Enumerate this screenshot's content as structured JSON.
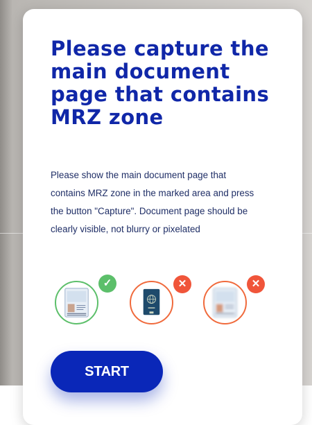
{
  "modal": {
    "title": "Please capture the main document page that contains MRZ zone",
    "description": "Please show the main document page that contains MRZ zone in the marked area and press the button \"Capture\". Document page should be clearly visible, not blurry or pixelated",
    "start_label": "START"
  },
  "examples": [
    {
      "image_icon": "document-page-icon",
      "status": "correct",
      "badge_icon": "checkmark-icon",
      "badge_glyph": "✓"
    },
    {
      "image_icon": "passport-cover-icon",
      "status": "incorrect",
      "badge_icon": "cross-icon",
      "badge_glyph": "✕"
    },
    {
      "image_icon": "blurry-document-icon",
      "status": "incorrect",
      "badge_icon": "cross-icon",
      "badge_glyph": "✕"
    }
  ],
  "colors": {
    "title": "#1027a8",
    "text": "#1f2e66",
    "button": "#0a27b8",
    "ok": "#5cbf6a",
    "error": "#f0553a"
  }
}
